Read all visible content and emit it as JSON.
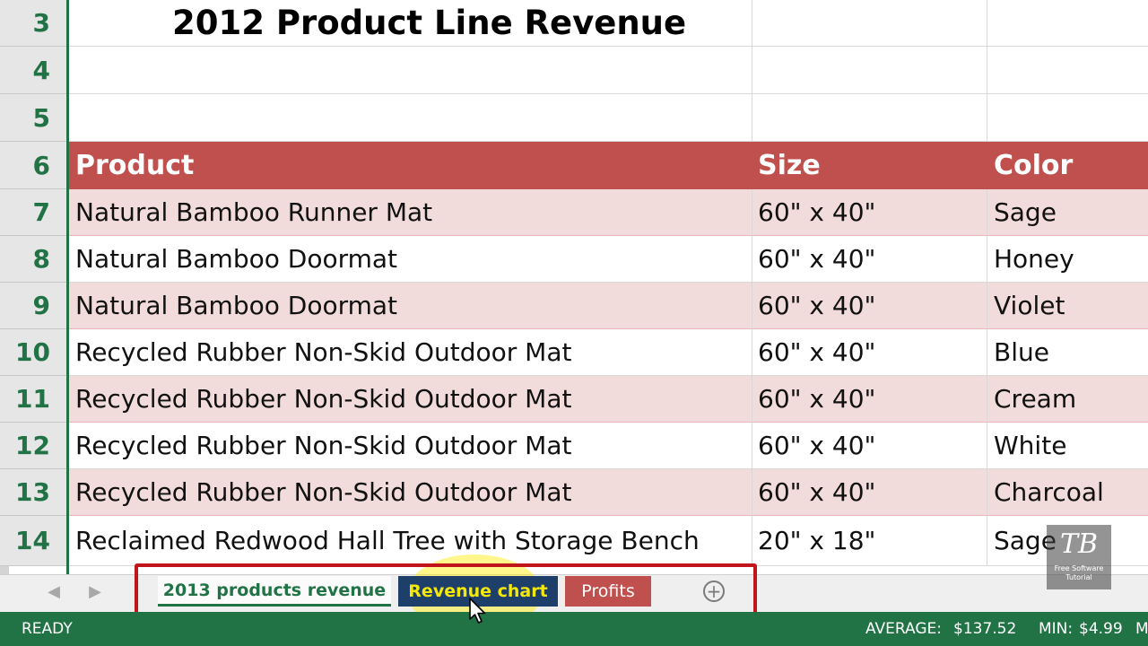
{
  "sheet": {
    "title_row": {
      "num": "3",
      "title": "2012 Product Line Revenue"
    },
    "blank_rows": [
      "4",
      "5"
    ],
    "header": {
      "num": "6",
      "product": "Product",
      "size": "Size",
      "color": "Color"
    },
    "rows": [
      {
        "num": "7",
        "product": "Natural Bamboo Runner Mat",
        "size": "60\" x 40\"",
        "color": "Sage"
      },
      {
        "num": "8",
        "product": "Natural Bamboo Doormat",
        "size": "60\" x 40\"",
        "color": "Honey"
      },
      {
        "num": "9",
        "product": "Natural Bamboo Doormat",
        "size": "60\" x 40\"",
        "color": "Violet"
      },
      {
        "num": "10",
        "product": "Recycled Rubber Non-Skid Outdoor Mat",
        "size": "60\" x 40\"",
        "color": "Blue"
      },
      {
        "num": "11",
        "product": "Recycled Rubber Non-Skid Outdoor Mat",
        "size": "60\" x 40\"",
        "color": "Cream"
      },
      {
        "num": "12",
        "product": "Recycled Rubber Non-Skid Outdoor Mat",
        "size": "60\" x 40\"",
        "color": "White"
      },
      {
        "num": "13",
        "product": "Recycled Rubber Non-Skid Outdoor Mat",
        "size": "60\" x 40\"",
        "color": "Charcoal"
      },
      {
        "num": "14",
        "product": "Reclaimed Redwood Hall Tree with Storage Bench",
        "size": "20\" x 18\"",
        "color": "Sage"
      }
    ]
  },
  "tabs": {
    "nav_prev": "◀",
    "nav_next": "▶",
    "items": [
      "2013 products revenue",
      "Revenue chart",
      "Profits"
    ],
    "add": "+"
  },
  "status": {
    "mode": "READY",
    "average_label": "AVERAGE:",
    "average_value": "$137.52",
    "min_label": "MIN:",
    "min_value": "$4.99",
    "cut": "M"
  },
  "watermark": {
    "logo": "TB",
    "caption_1": "Free Software",
    "caption_2": "Tutorial"
  },
  "colors": {
    "header_fill": "#c0504d",
    "band_fill": "#f2dcdb",
    "excel_green": "#217346",
    "annotation_red": "#c0151b"
  }
}
